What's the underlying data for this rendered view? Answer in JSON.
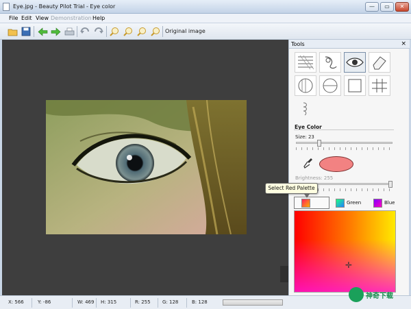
{
  "window": {
    "title": "Eye.jpg - Beauty Pilot Trial - Eye color",
    "minimize_glyph": "—",
    "maximize_glyph": "▭",
    "close_glyph": "✕"
  },
  "menu": {
    "file": "File",
    "edit": "Edit",
    "view": "View",
    "demonstration": "Demonstration",
    "help": "Help"
  },
  "toolbar": {
    "original_image_label": "Original image",
    "icons": [
      "open-folder-icon",
      "save-icon",
      "back-arrow-icon",
      "forward-arrow-icon",
      "print-icon",
      "undo-icon",
      "redo-icon",
      "zoom-in-icon",
      "zoom-out-icon",
      "zoom-fit-icon",
      "zoom-actual-icon"
    ]
  },
  "tools_panel": {
    "title": "Tools",
    "close_glyph": "×",
    "tools": [
      "texture-tool-icon",
      "retouch-tool-icon",
      "eye-color-tool-icon",
      "eraser-tool-icon",
      "sphere-tool-icon",
      "ellipse-tool-icon",
      "rectangle-tool-icon",
      "grid-tool-icon",
      "squiggle-tool-icon"
    ],
    "active_tool": "eye-color-tool-icon"
  },
  "eye_color": {
    "heading": "Eye Color",
    "size_label": "Size: 23",
    "size_fraction": 0.23,
    "swatch_color": "#f28282",
    "brightness_label": "Brightness: 255",
    "brightness_fraction": 1.0
  },
  "tooltip": {
    "text": "Select Red Palette"
  },
  "palettes": {
    "red": "",
    "green": "Green",
    "blue": "Blue"
  },
  "status": {
    "x": "X: 566",
    "y": "Y: -86",
    "w": "W: 469",
    "h": "H: 315",
    "r": "R: 255",
    "g": "G: 128",
    "b": "B: 128"
  },
  "watermark": {
    "text": "神奇下载"
  },
  "colors": {
    "canvas_bg": "#3e3e3e",
    "title_gradient_top": "#e6eef8",
    "swatch": "#f28282"
  }
}
